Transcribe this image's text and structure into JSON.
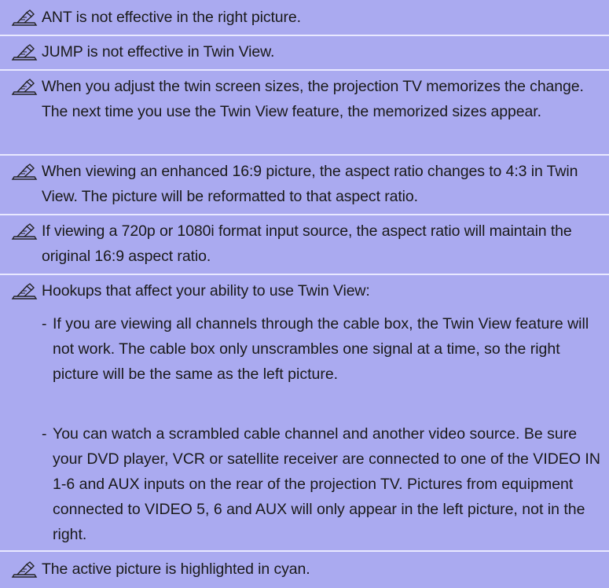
{
  "notes": [
    {
      "text": "ANT is not effective in the right picture."
    },
    {
      "text": "JUMP is not effective in Twin View."
    },
    {
      "text": "When you adjust the twin screen sizes, the projection TV memorizes the change. The next time you use the Twin View feature, the memorized sizes appear."
    },
    {
      "text": "When viewing an enhanced 16:9 picture, the aspect ratio changes to 4:3 in Twin View. The picture will be reformatted to that aspect ratio."
    },
    {
      "text": "If viewing a 720p or 1080i format input source, the aspect ratio will maintain the original 16:9 aspect ratio."
    },
    {
      "text": "Hookups that affect your ability to use Twin View:"
    },
    {
      "text": "The active picture is highlighted in cyan."
    }
  ],
  "sub_items": [
    {
      "dash": "-",
      "text": "If you are viewing all channels through the cable box, the Twin View feature will not work. The cable box only unscrambles one signal at a time, so the right picture will be the same as the left picture."
    },
    {
      "dash": "-",
      "text": "You can watch a scrambled cable channel and another video source. Be sure your DVD player, VCR or satellite receiver are connected to one of the VIDEO IN 1-6 and AUX inputs on the rear of the projection TV. Pictures from equipment connected to VIDEO 5, 6 and AUX will only appear in the left picture, not in the right."
    }
  ],
  "colors": {
    "panel_background": "#b3b3f5",
    "separator": "#e8e8ff",
    "text": "#1a1a1a"
  },
  "icon": "writing-hand-note-icon"
}
